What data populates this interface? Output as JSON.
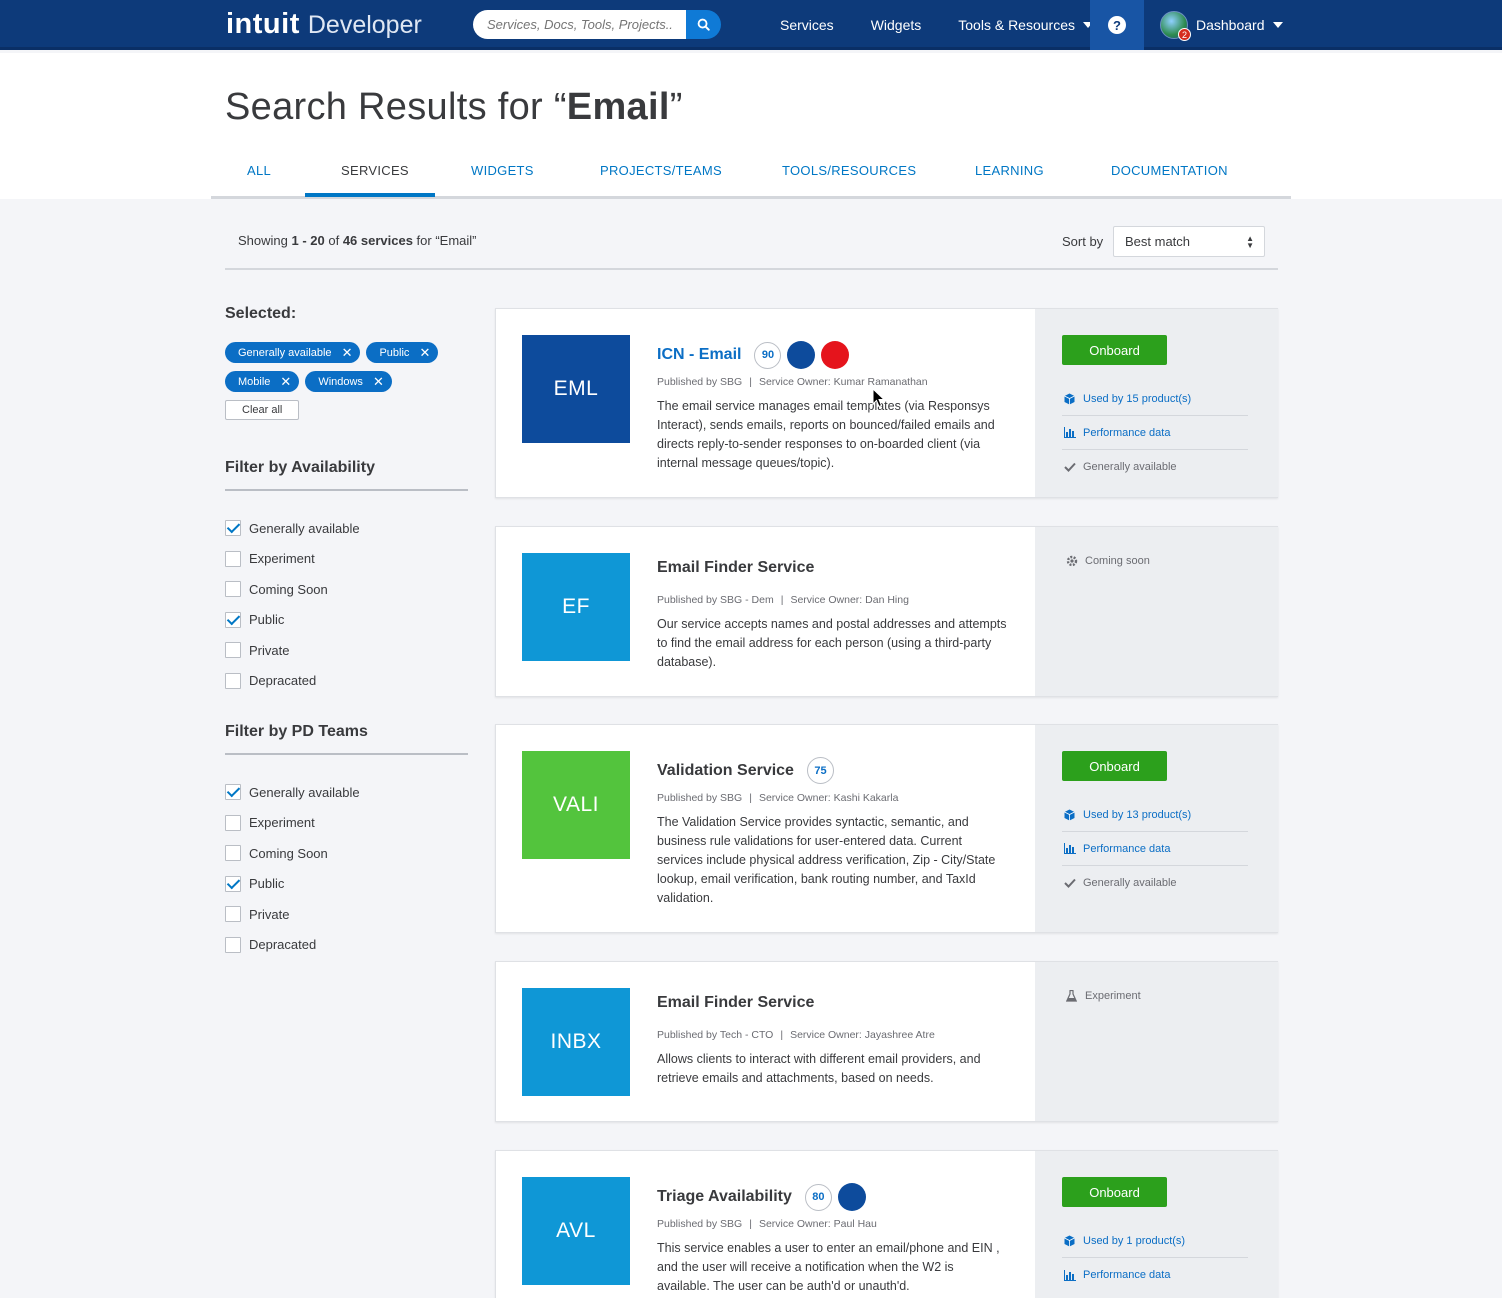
{
  "nav": {
    "brand": "intuit",
    "product": "Developer",
    "search_placeholder": "Services, Docs, Tools, Projects...",
    "links": [
      "Services",
      "Widgets",
      "Tools & Resources"
    ],
    "help": "?",
    "dashboard": "Dashboard",
    "notification_count": "2"
  },
  "header": {
    "title_prefix": "Search Results for “",
    "query": "Email",
    "title_suffix": "”",
    "tabs": [
      "ALL",
      "SERVICES",
      "WIDGETS",
      "PROJECTS/TEAMS",
      "TOOLS/RESOURCES",
      "LEARNING",
      "DOCUMENTATION"
    ],
    "active_tab": "SERVICES"
  },
  "results": {
    "showing_prefix": "Showing ",
    "range": "1 - 20",
    "of": " of ",
    "count": "46 services",
    "for": " for “Email”",
    "sort_label": "Sort by",
    "sort_value": "Best match"
  },
  "sidebar": {
    "selected_title": "Selected:",
    "chips": [
      "Generally available",
      "Public",
      "Mobile",
      "Windows"
    ],
    "clear_all": "Clear all",
    "availability_title": "Filter by Availability",
    "availability": [
      {
        "label": "Generally available",
        "checked": true
      },
      {
        "label": "Experiment",
        "checked": false
      },
      {
        "label": "Coming Soon",
        "checked": false
      },
      {
        "label": "Public",
        "checked": true
      },
      {
        "label": "Private",
        "checked": false
      },
      {
        "label": "Depracated",
        "checked": false
      }
    ],
    "teams_title": "Filter by PD Teams",
    "teams": [
      {
        "label": "Generally available",
        "checked": true
      },
      {
        "label": "Experiment",
        "checked": false
      },
      {
        "label": "Coming Soon",
        "checked": false
      },
      {
        "label": "Public",
        "checked": true
      },
      {
        "label": "Private",
        "checked": false
      },
      {
        "label": "Depracated",
        "checked": false
      }
    ]
  },
  "cards": [
    {
      "tile": "EML",
      "tile_color": "#0d4b9c",
      "title": "ICN - Email",
      "score": "90",
      "publisher": "Published by SBG",
      "owner": "Service Owner: Kumar Ramanathan",
      "description": "The email service manages email templates (via Responsys Interact), sends emails, reports on bounced/failed emails and directs reply-to-sender responses to on-boarded client (via internal message queues/topic).",
      "onboard": "Onboard",
      "used_by": "Used by 15 product(s)",
      "perf": "Performance data",
      "avail": "Generally available"
    },
    {
      "tile": "EF",
      "tile_color": "#0f97d6",
      "title": "Email Finder Service",
      "publisher": "Published by SBG - Dem",
      "owner": "Service Owner: Dan Hing",
      "description": "Our service accepts names and postal addresses and attempts to find the email address for each person (using a third-party database).",
      "status": "Coming soon"
    },
    {
      "tile": "VALI",
      "tile_color": "#53c43d",
      "title": "Validation Service",
      "score": "75",
      "publisher": "Published by SBG",
      "owner": "Service Owner: Kashi Kakarla",
      "description": "The Validation Service provides syntactic, semantic, and business rule validations for user-entered data. Current services include physical address verification, Zip - City/State lookup, email verification, bank routing number, and TaxId validation.",
      "onboard": "Onboard",
      "used_by": "Used by 13 product(s)",
      "perf": "Performance data",
      "avail": "Generally available"
    },
    {
      "tile": "INBX",
      "tile_color": "#0f97d6",
      "title": "Email Finder Service",
      "publisher": "Published by Tech - CTO",
      "owner": "Service Owner: Jayashree Atre",
      "description": "Allows clients to interact with different email providers, and retrieve emails and attachments, based on needs.",
      "status": "Experiment"
    },
    {
      "tile": "AVL",
      "tile_color": "#0f97d6",
      "title": "Triage Availability",
      "score": "80",
      "publisher": "Published by SBG",
      "owner": "Service Owner: Paul Hau",
      "description": "This service enables a user to enter an email/phone and EIN , and the user will receive a notification when the W2 is available. The user can be auth'd or unauth'd.",
      "onboard": "Onboard",
      "used_by": "Used by 1 product(s)",
      "perf": "Performance data"
    }
  ],
  "colors": {
    "nav_bg": "#0d3a7a",
    "accent_blue": "#0b6ec5",
    "onboard_green": "#2ca01c",
    "dot_blue": "#0d4b9c",
    "dot_red": "#e5141c"
  }
}
